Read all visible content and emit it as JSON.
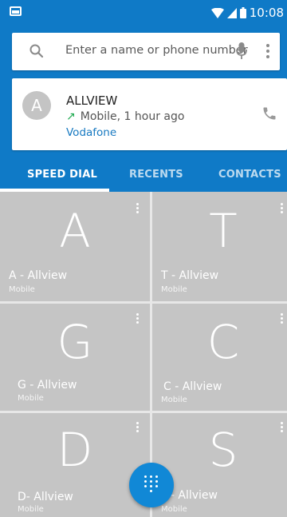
{
  "status_bar": {
    "time": "10:08",
    "icons": [
      "screenshot-notification-icon",
      "wifi-icon",
      "signal-icon",
      "battery-icon"
    ]
  },
  "search": {
    "placeholder": "Enter a name or phone number",
    "icons": [
      "search-icon",
      "microphone-icon",
      "more-vert-icon"
    ]
  },
  "recent_call": {
    "avatar_letter": "A",
    "name": "ALLVIEW",
    "call_type_icon": "outgoing-call-arrow-icon",
    "detail": "Mobile, 1 hour ago",
    "carrier": "Vodafone"
  },
  "tabs": [
    {
      "label": "SPEED DIAL",
      "active": true
    },
    {
      "label": "RECENTS",
      "active": false
    },
    {
      "label": "CONTACTS",
      "active": false
    }
  ],
  "speed_dial": [
    {
      "letter": "A",
      "name": "A - Allview",
      "type": "Mobile"
    },
    {
      "letter": "T",
      "name": "T - Allview",
      "type": "Mobile"
    },
    {
      "letter": "G",
      "name": "G - Allview",
      "type": "Mobile"
    },
    {
      "letter": "C",
      "name": "C - Allview",
      "type": "Mobile"
    },
    {
      "letter": "D",
      "name": "D- Allview",
      "type": "Mobile"
    },
    {
      "letter": "S",
      "name": "S- Allview",
      "type": "Mobile"
    }
  ],
  "fab": {
    "icon": "dialpad-icon"
  },
  "colors": {
    "primary": "#0f7ac7",
    "tile": "#c5c5c5",
    "fab": "#1188d6",
    "outgoing": "#1eaa4f",
    "carrier": "#1779c1"
  }
}
